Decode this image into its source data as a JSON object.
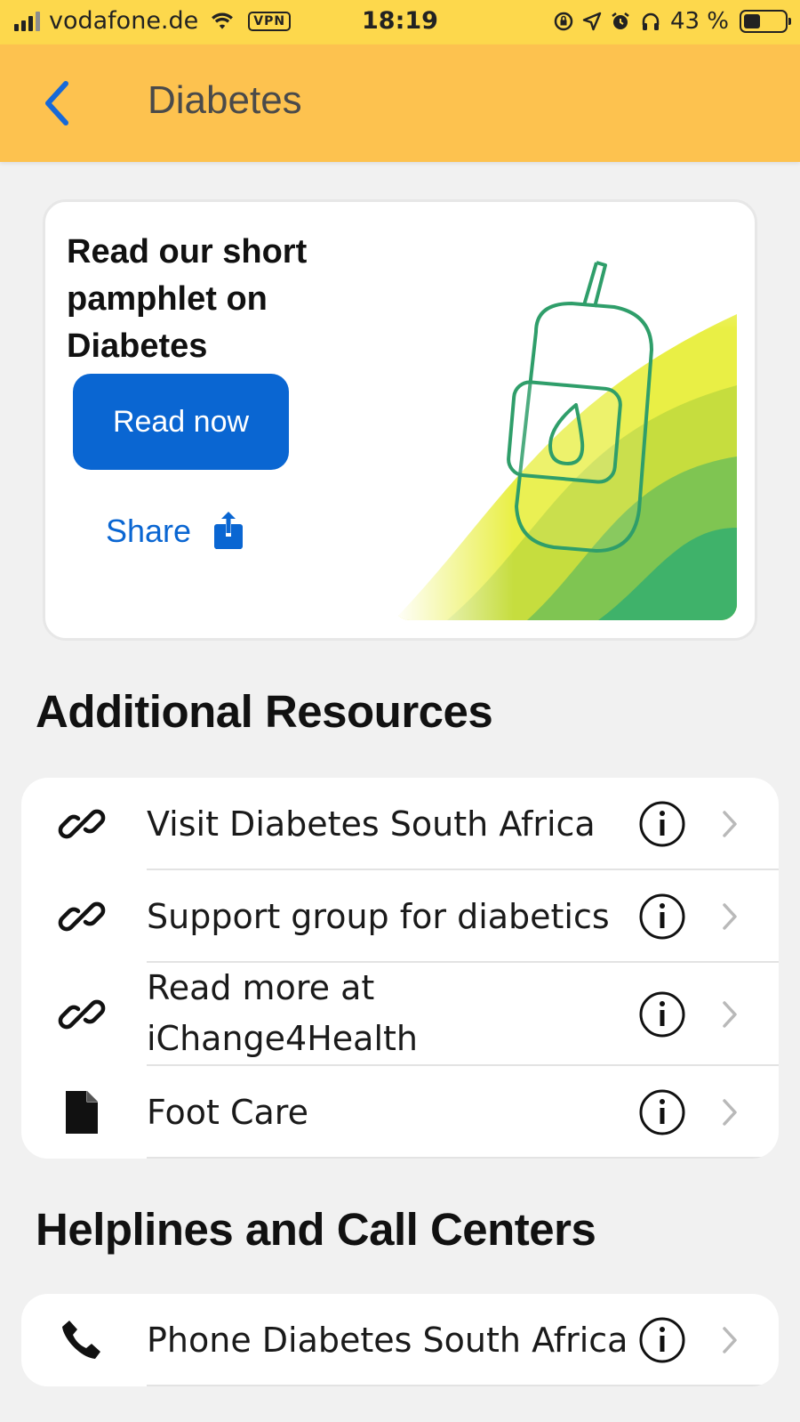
{
  "status_bar": {
    "carrier": "vodafone.de",
    "vpn_label": "VPN",
    "time": "18:19",
    "battery_text": "43 %",
    "battery_level": 0.43,
    "icons": [
      "signal-icon",
      "wifi-icon",
      "screen-lock-icon",
      "location-icon",
      "alarm-icon",
      "headphones-icon",
      "battery-icon"
    ]
  },
  "nav": {
    "title": "Diabetes",
    "back_icon": "chevron-left-icon"
  },
  "pamphlet": {
    "title": "Read our short pamphlet on Diabetes",
    "read_button": "Read now",
    "share_label": "Share",
    "share_icon": "share-icon",
    "illustration": "glucose-meter-illustration"
  },
  "additional_resources": {
    "title": "Additional Resources",
    "items": [
      {
        "label": "Visit Diabetes South Africa",
        "icon": "link-icon"
      },
      {
        "label": "Support group for diabetics",
        "icon": "link-icon"
      },
      {
        "label": "Read more at iChange4Health",
        "icon": "link-icon"
      },
      {
        "label": "Foot Care",
        "icon": "document-icon"
      }
    ]
  },
  "helplines": {
    "title": "Helplines and Call Centers",
    "items": [
      {
        "label": "Phone Diabetes South Africa",
        "icon": "phone-icon"
      }
    ]
  },
  "colors": {
    "status_bar": "#fdd84c",
    "nav_bar": "#fdc24f",
    "accent_blue": "#0a66d2",
    "background": "#f1f1f1"
  }
}
